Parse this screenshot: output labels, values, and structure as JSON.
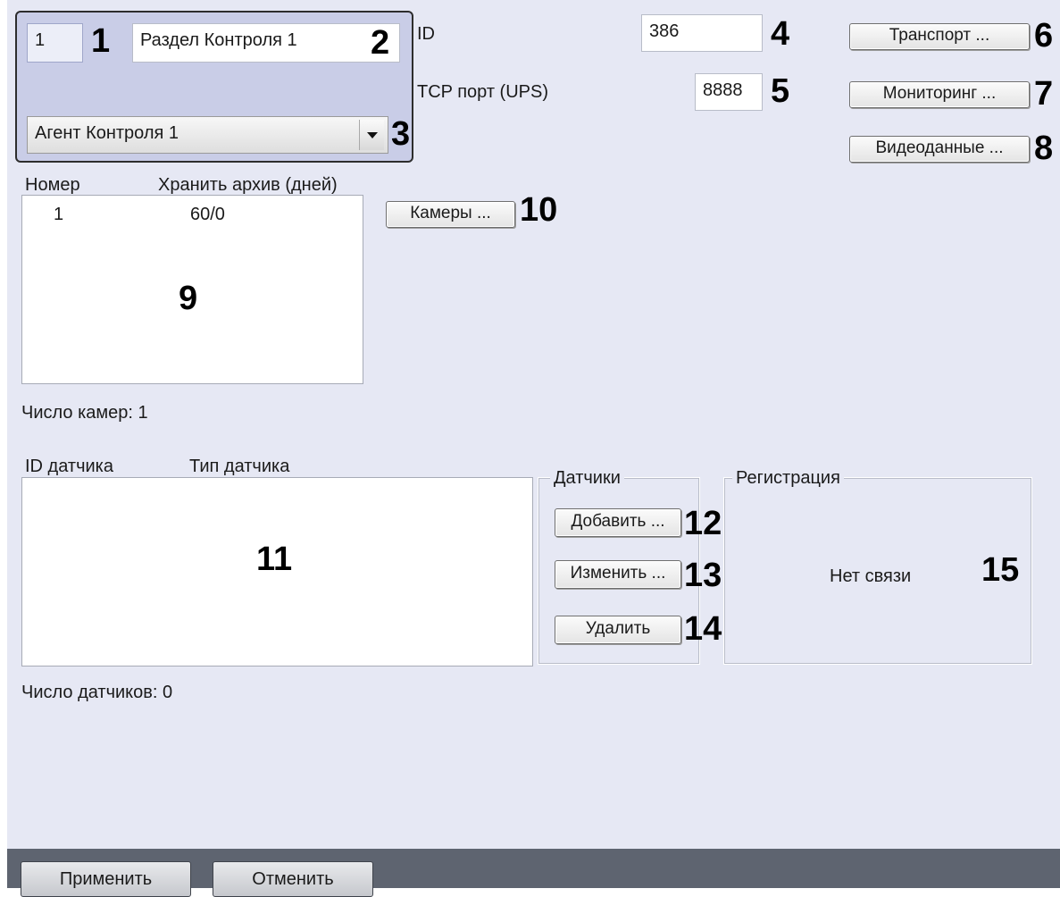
{
  "header_group": {
    "number": "1",
    "section_name": "Раздел Контроля 1",
    "agent_selected": "Агент Контроля 1"
  },
  "fields": {
    "id_label": "ID",
    "id_value": "386",
    "tcp_label": "TCP порт (UPS)",
    "tcp_value": "8888"
  },
  "buttons": {
    "transport": "Транспорт ...",
    "monitoring": "Мониторинг ...",
    "videodata": "Видеоданные ...",
    "cameras": "Камеры ...",
    "add": "Добавить ...",
    "edit": "Изменить ...",
    "delete": "Удалить",
    "apply": "Применить",
    "cancel": "Отменить"
  },
  "camera_list": {
    "columns": [
      "Номер",
      "Хранить архив (дней)"
    ],
    "rows": [
      {
        "number": "1",
        "archive": "60/0"
      }
    ],
    "count_text": "Число камер: 1"
  },
  "sensor_list": {
    "columns": [
      "ID датчика",
      "Тип датчика"
    ],
    "rows": [],
    "count_text": "Число датчиков: 0"
  },
  "sensors_group_title": "Датчики",
  "registration_group": {
    "title": "Регистрация",
    "status": "Нет связи"
  },
  "callouts": {
    "c1": "1",
    "c2": "2",
    "c3": "3",
    "c4": "4",
    "c5": "5",
    "c6": "6",
    "c7": "7",
    "c8": "8",
    "c9": "9",
    "c10": "10",
    "c11": "11",
    "c12": "12",
    "c13": "13",
    "c14": "14",
    "c15": "15"
  },
  "icons": {
    "dropdown": "chevron-down-icon"
  }
}
